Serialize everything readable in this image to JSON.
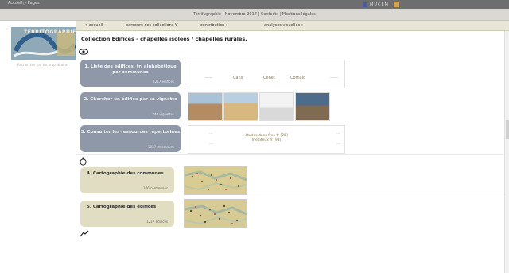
{
  "topbar": {
    "crumb": "Accueil  ▷  Pages",
    "logo_text": "MUCEM"
  },
  "subbar": {
    "links": "Terrifugraphie  |  Novembre 2017  |  Contacts  |  Mentions légales"
  },
  "brand": {
    "wordmark": "TERRITOGRAPHIE"
  },
  "nav": [
    {
      "label": "< accueil"
    },
    {
      "label": "parcours des collections ∀"
    },
    {
      "label": "contribution »"
    },
    {
      "label": "analyses visuelles »"
    }
  ],
  "side_note": "Rechercher par les propriétaires",
  "page_title": "Collection Edifices - chapelles isolées / chapelles rurales.",
  "cards": [
    {
      "title": "1. Liste des édifices, tri alphabétique par communes",
      "meta": "1217 édifices"
    },
    {
      "title": "2. Chercher un édifice par sa vignette",
      "meta": "240 vignettes"
    },
    {
      "title": "3. Consulter les ressources répertoriées",
      "meta": "5037 ressources"
    },
    {
      "title": "4. Cartographie des communes",
      "meta": "376 communes"
    },
    {
      "title": "5. Cartographie des édifices",
      "meta": "1217 édifices"
    }
  ],
  "panel1": {
    "links": [
      "Cans",
      "Cenet",
      "Cornalo"
    ]
  },
  "panel3": {
    "lines": [
      "études dans free fr [25]",
      "mediteux fr [93]"
    ]
  },
  "colors": {
    "gray_card": "#8e98a8",
    "beige_card": "#e1ddc3",
    "accent": "#d6a14a"
  },
  "icons": {
    "section1": "eye-icon",
    "section2": "compass-icon",
    "section3": "tools-icon"
  }
}
